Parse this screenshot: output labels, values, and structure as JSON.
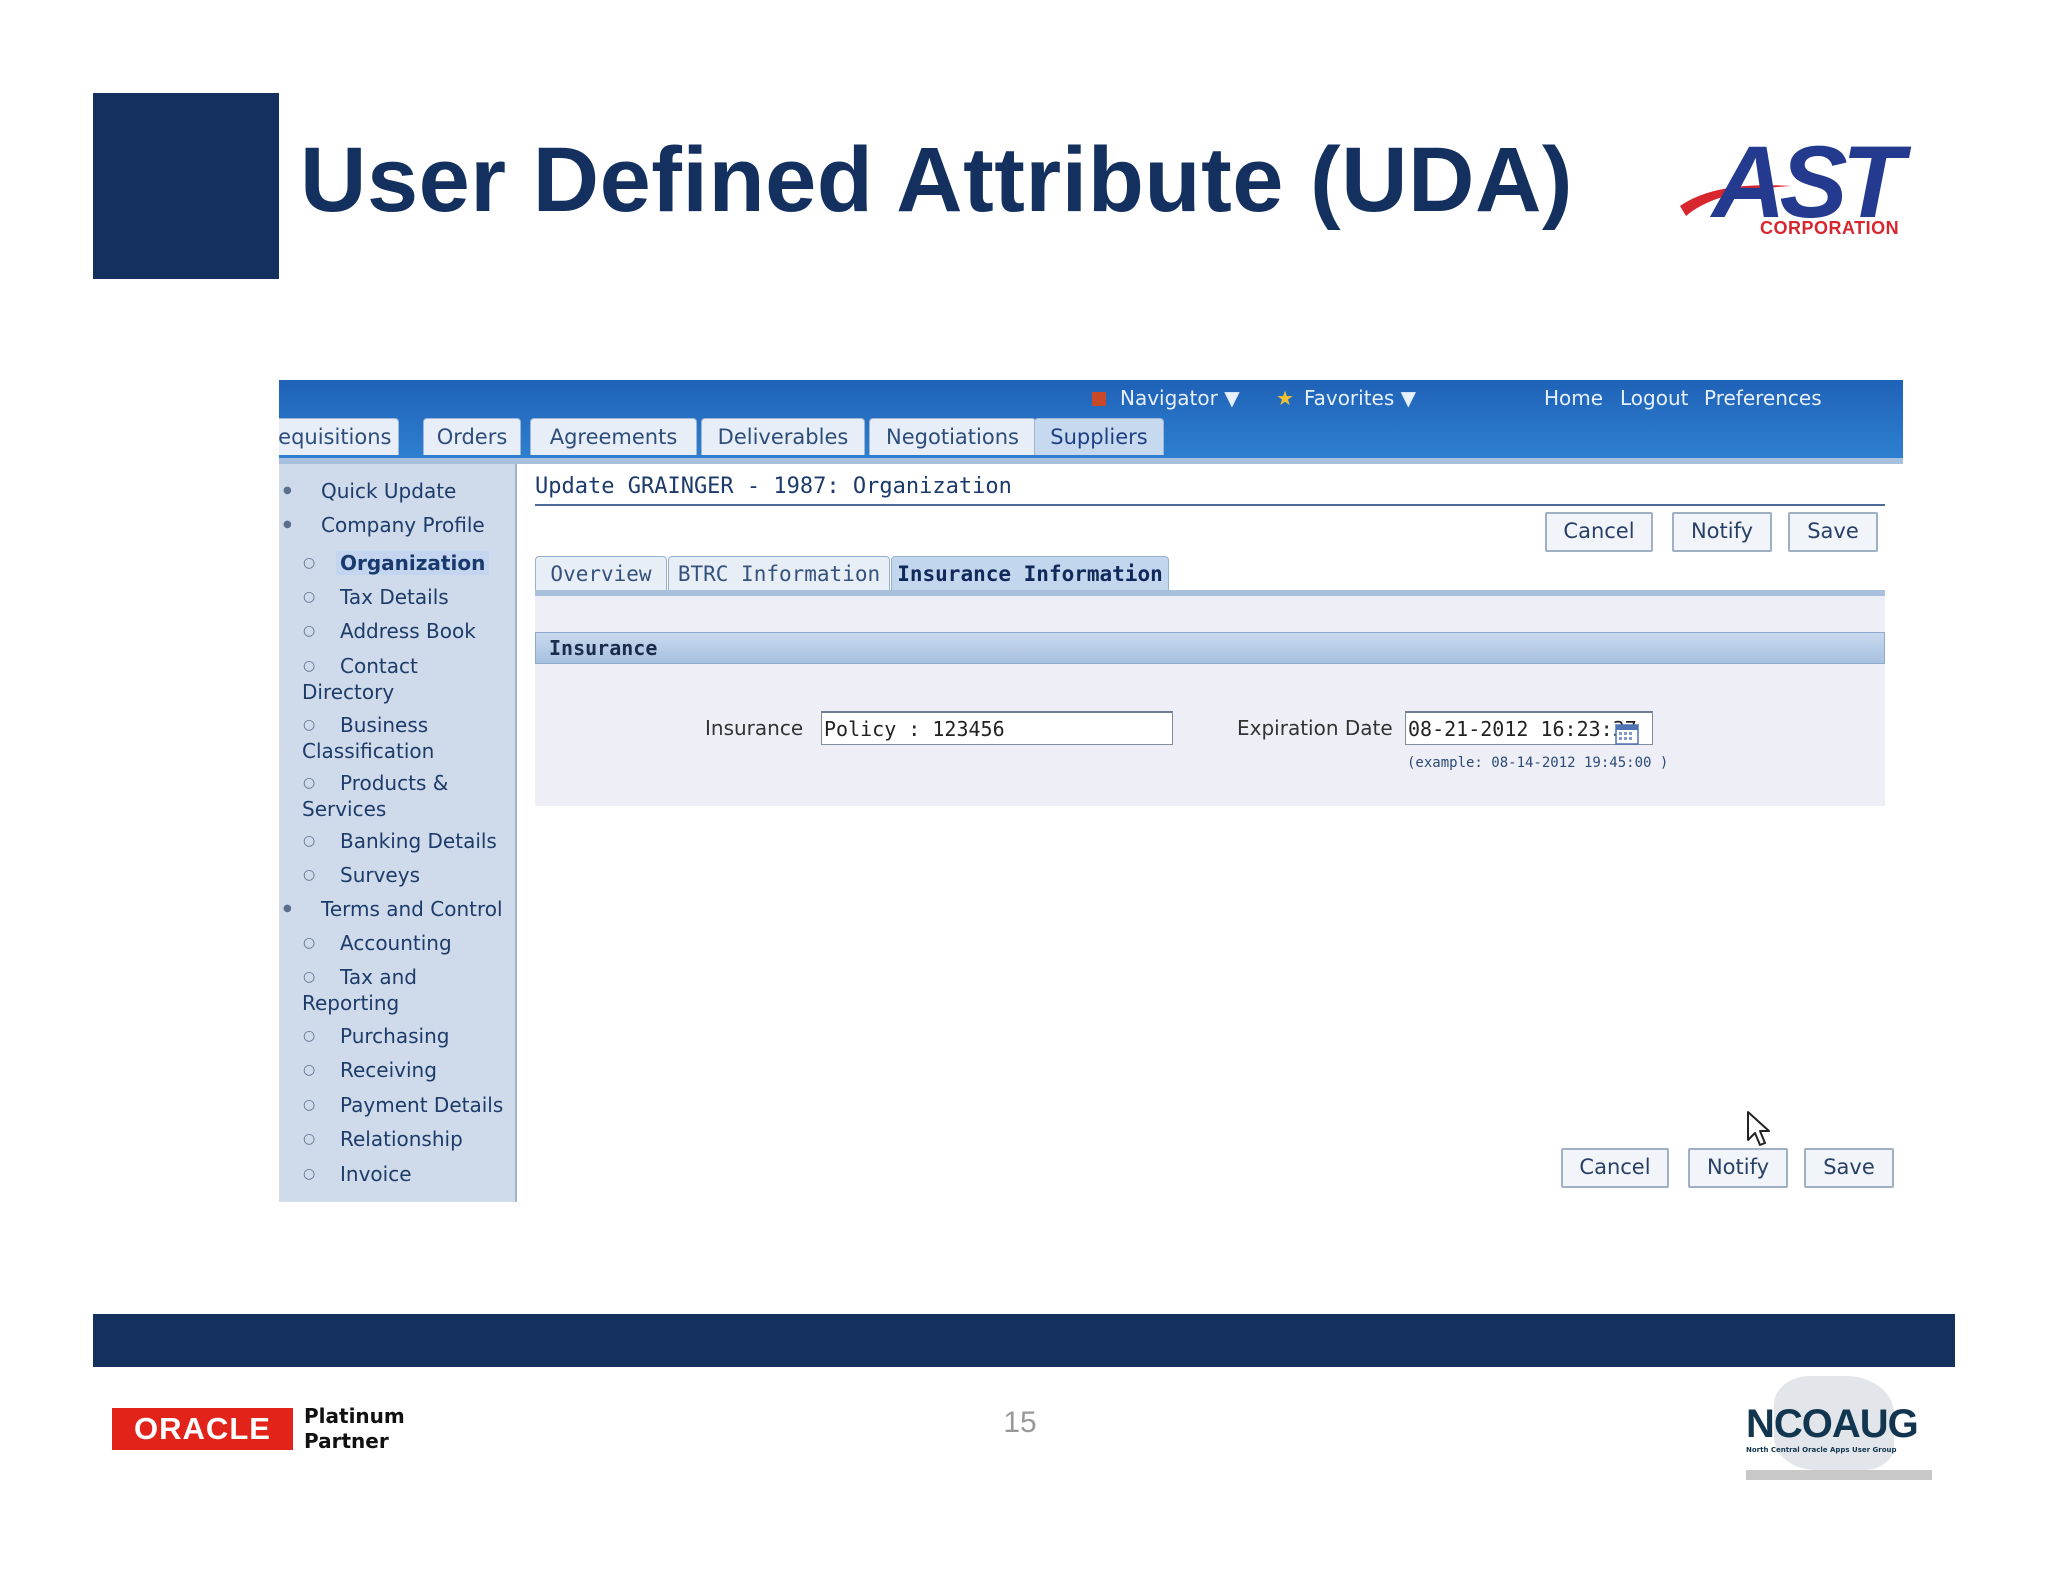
{
  "slide": {
    "title": "User Defined Attribute (UDA)",
    "page_number": "15",
    "ast_logo": {
      "text": "AST",
      "subtext": "CORPORATION"
    },
    "oracle_logo": {
      "text": "ORACLE",
      "partner_line1": "Platinum",
      "partner_line2": "Partner"
    },
    "ncoaug_logo": {
      "text": "NCOAUG",
      "subtext": "North Central Oracle Apps User Group"
    }
  },
  "app": {
    "header_links": {
      "navigator": "Navigator",
      "favorites": "Favorites",
      "home": "Home",
      "logout": "Logout",
      "preferences": "Preferences"
    },
    "top_tabs": [
      {
        "label": "Requisitions",
        "active": false
      },
      {
        "label": "Orders",
        "active": false
      },
      {
        "label": "Agreements",
        "active": false
      },
      {
        "label": "Deliverables",
        "active": false
      },
      {
        "label": "Negotiations",
        "active": false
      },
      {
        "label": "Suppliers",
        "active": true
      }
    ],
    "sidebar": {
      "items": [
        {
          "label": "Quick Update",
          "level": 1
        },
        {
          "label": "Company Profile",
          "level": 1
        },
        {
          "label": "Organization",
          "level": 2,
          "selected": true
        },
        {
          "label": "Tax Details",
          "level": 2
        },
        {
          "label": "Address Book",
          "level": 2
        },
        {
          "label": "Contact",
          "label2": "Directory",
          "level": 2
        },
        {
          "label": "Business",
          "label2": "Classification",
          "level": 2
        },
        {
          "label": "Products &",
          "label2": "Services",
          "level": 2
        },
        {
          "label": "Banking Details",
          "level": 2
        },
        {
          "label": "Surveys",
          "level": 2
        },
        {
          "label": "Terms and Control",
          "level": 1
        },
        {
          "label": "Accounting",
          "level": 2
        },
        {
          "label": "Tax and",
          "label2": "Reporting",
          "level": 2
        },
        {
          "label": "Purchasing",
          "level": 2
        },
        {
          "label": "Receiving",
          "level": 2
        },
        {
          "label": "Payment Details",
          "level": 2
        },
        {
          "label": "Relationship",
          "level": 2
        },
        {
          "label": "Invoice",
          "level": 2
        }
      ]
    },
    "page_heading": "Update GRAINGER - 1987: Organization",
    "buttons": {
      "cancel": "Cancel",
      "notify": "Notify",
      "save": "Save"
    },
    "sub_tabs": [
      {
        "label": "Overview",
        "active": false
      },
      {
        "label": "BTRC Information",
        "active": false
      },
      {
        "label": "Insurance Information",
        "active": true
      }
    ],
    "section_title": "Insurance",
    "insurance_field": {
      "label": "Insurance",
      "value": "Policy : 123456"
    },
    "expiration_field": {
      "label": "Expiration Date",
      "value": "08-21-2012 16:23:37",
      "example": "(example: 08-14-2012 19:45:00 )"
    }
  }
}
